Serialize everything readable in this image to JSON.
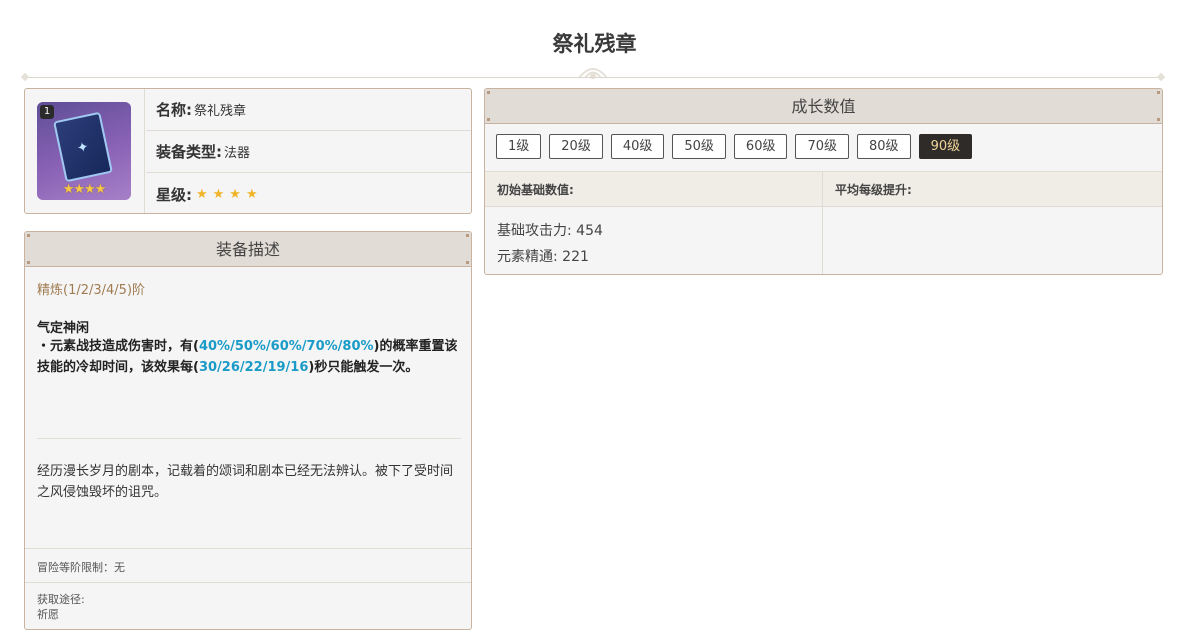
{
  "page": {
    "title": "祭礼残章"
  },
  "weapon": {
    "level_badge": "1",
    "stars_glyph": "★★★★",
    "name_label": "名称:",
    "name": "祭礼残章",
    "type_label": "装备类型:",
    "type": "法器",
    "rarity_label": "星级:",
    "rarity_stars": "★★★★",
    "rarity_value": 4
  },
  "description": {
    "header": "装备描述",
    "refinement": "精炼(1/2/3/4/5)阶",
    "skill_name": "气定神闲",
    "skill_prefix": "・元素战技造成伤害时，有(",
    "skill_chance": "40%/50%/60%/70%/80%",
    "skill_mid": ")的概率重置该技能的冷却时间，该效果每(",
    "skill_cooldown": "30/26/22/19/16",
    "skill_suffix": ")秒只能触发一次。",
    "lore": "经历漫长岁月的剧本，记载着的颂词和剧本已经无法辨认。被下了受时间之风侵蚀毁坏的诅咒。",
    "adventure_rank": "冒险等阶限制：无",
    "source_label": "获取途径:",
    "source": "祈愿"
  },
  "growth": {
    "header": "成长数值",
    "levels": [
      "1级",
      "20级",
      "40级",
      "50级",
      "60级",
      "70级",
      "80级",
      "90级"
    ],
    "active_level": "90级",
    "base_header": "初始基础数值:",
    "per_level_header": "平均每级提升:",
    "stat1": "基础攻击力: 454",
    "stat2": "元素精通: 221"
  },
  "colors": {
    "accent_blue": "#1a9bc7",
    "refine_brown": "#a07c52",
    "active_gold": "#f0d49a"
  }
}
